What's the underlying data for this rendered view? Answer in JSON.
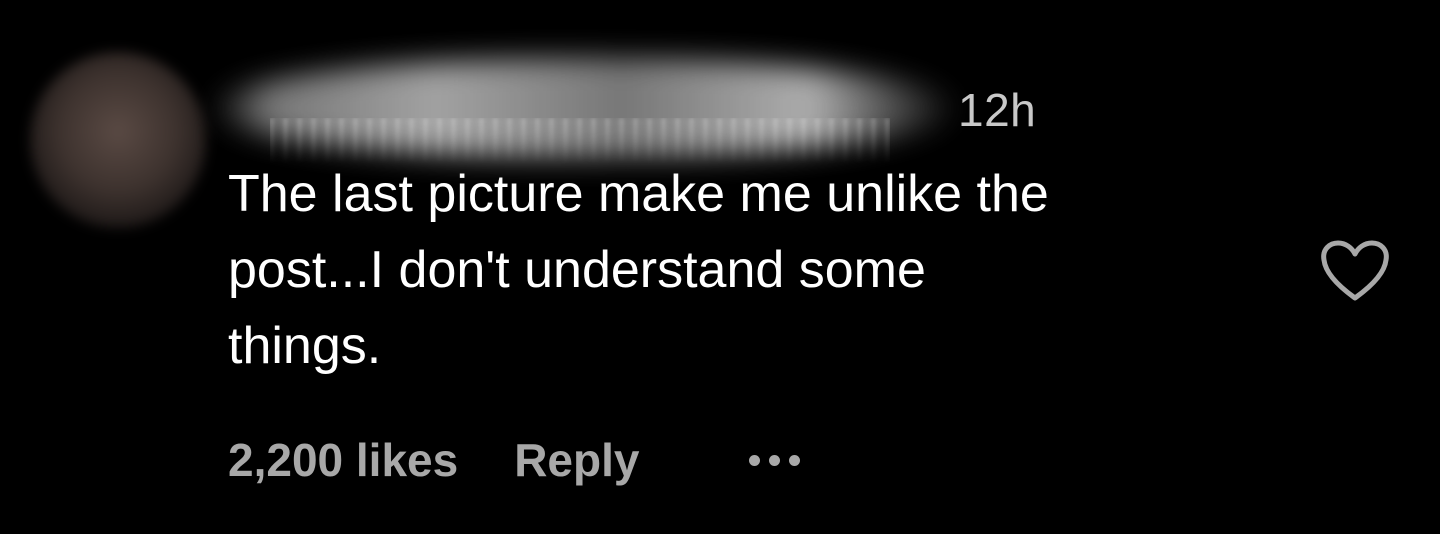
{
  "comment": {
    "timestamp": "12h",
    "text": "The last picture make me unlike the\npost...I don't understand some\nthings.",
    "likes": "2,200 likes",
    "reply_label": "Reply",
    "more_icon": "ellipsis-icon",
    "like_icon": "heart-outline-icon",
    "avatar_blurred": true,
    "username_blurred": true
  },
  "colors": {
    "background": "#000000",
    "text": "#ffffff",
    "secondary": "#a8a8a8",
    "timestamp": "#c8c8c8"
  }
}
